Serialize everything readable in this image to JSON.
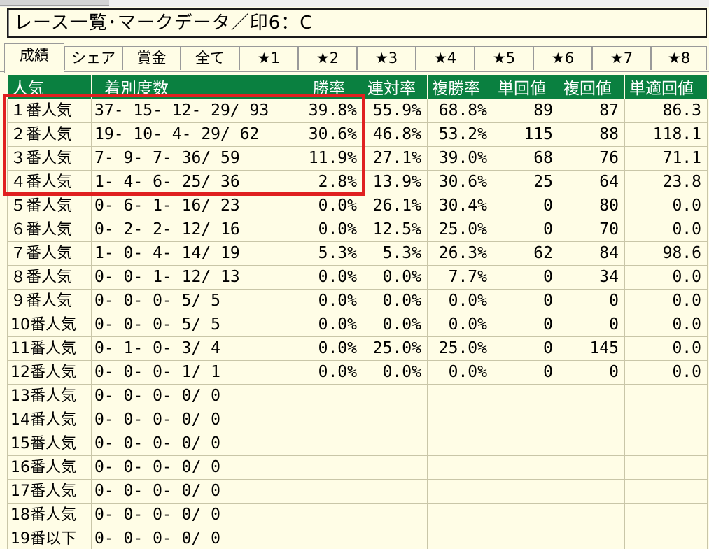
{
  "window": {
    "title": "レース一覧･マークデータ／印6：C"
  },
  "tabs": [
    {
      "label": "成績",
      "active": true
    },
    {
      "label": "シェア",
      "active": false
    },
    {
      "label": "賞金",
      "active": false
    },
    {
      "label": "全て",
      "active": false
    },
    {
      "label": "★1",
      "active": false
    },
    {
      "label": "★2",
      "active": false
    },
    {
      "label": "★3",
      "active": false
    },
    {
      "label": "★4",
      "active": false
    },
    {
      "label": "★5",
      "active": false
    },
    {
      "label": "★6",
      "active": false
    },
    {
      "label": "★7",
      "active": false
    },
    {
      "label": "★8",
      "active": false
    }
  ],
  "table": {
    "headers": {
      "popularity": "人気",
      "record": "着別度数",
      "win_rate": "勝率",
      "quinella_rate": "連対率",
      "place_rate": "複勝率",
      "win_return": "単回値",
      "place_return": "複回値",
      "adj_win_return": "単適回値"
    },
    "rows": [
      {
        "label": "１番人気",
        "record": "37- 15- 12- 29/ 93",
        "win_rate": "39.8%",
        "quinella_rate": "55.9%",
        "place_rate": "68.8%",
        "win_return": "89",
        "place_return": "87",
        "adj_win_return": "86.3"
      },
      {
        "label": "２番人気",
        "record": "19- 10-  4- 29/ 62",
        "win_rate": "30.6%",
        "quinella_rate": "46.8%",
        "place_rate": "53.2%",
        "win_return": "115",
        "place_return": "88",
        "adj_win_return": "118.1"
      },
      {
        "label": "３番人気",
        "record": " 7-  9-  7- 36/ 59",
        "win_rate": "11.9%",
        "quinella_rate": "27.1%",
        "place_rate": "39.0%",
        "win_return": "68",
        "place_return": "76",
        "adj_win_return": "71.1"
      },
      {
        "label": "４番人気",
        "record": " 1-  4-  6- 25/ 36",
        "win_rate": "2.8%",
        "quinella_rate": "13.9%",
        "place_rate": "30.6%",
        "win_return": "25",
        "place_return": "64",
        "adj_win_return": "23.8"
      },
      {
        "label": "５番人気",
        "record": " 0-  6-  1- 16/ 23",
        "win_rate": "0.0%",
        "quinella_rate": "26.1%",
        "place_rate": "30.4%",
        "win_return": "0",
        "place_return": "80",
        "adj_win_return": "0.0"
      },
      {
        "label": "６番人気",
        "record": " 0-  2-  2- 12/ 16",
        "win_rate": "0.0%",
        "quinella_rate": "12.5%",
        "place_rate": "25.0%",
        "win_return": "0",
        "place_return": "70",
        "adj_win_return": "0.0"
      },
      {
        "label": "７番人気",
        "record": " 1-  0-  4- 14/ 19",
        "win_rate": "5.3%",
        "quinella_rate": "5.3%",
        "place_rate": "26.3%",
        "win_return": "62",
        "place_return": "84",
        "adj_win_return": "98.6"
      },
      {
        "label": "８番人気",
        "record": " 0-  0-  1- 12/ 13",
        "win_rate": "0.0%",
        "quinella_rate": "0.0%",
        "place_rate": "7.7%",
        "win_return": "0",
        "place_return": "34",
        "adj_win_return": "0.0"
      },
      {
        "label": "９番人気",
        "record": " 0-  0-  0-  5/  5",
        "win_rate": "0.0%",
        "quinella_rate": "0.0%",
        "place_rate": "0.0%",
        "win_return": "0",
        "place_return": "0",
        "adj_win_return": "0.0"
      },
      {
        "label": "10番人気",
        "record": " 0-  0-  0-  5/  5",
        "win_rate": "0.0%",
        "quinella_rate": "0.0%",
        "place_rate": "0.0%",
        "win_return": "0",
        "place_return": "0",
        "adj_win_return": "0.0"
      },
      {
        "label": "11番人気",
        "record": " 0-  1-  0-  3/  4",
        "win_rate": "0.0%",
        "quinella_rate": "25.0%",
        "place_rate": "25.0%",
        "win_return": "0",
        "place_return": "145",
        "adj_win_return": "0.0"
      },
      {
        "label": "12番人気",
        "record": " 0-  0-  0-  1/  1",
        "win_rate": "0.0%",
        "quinella_rate": "0.0%",
        "place_rate": "0.0%",
        "win_return": "0",
        "place_return": "0",
        "adj_win_return": "0.0"
      },
      {
        "label": "13番人気",
        "record": " 0-  0-  0-  0/  0",
        "win_rate": "",
        "quinella_rate": "",
        "place_rate": "",
        "win_return": "",
        "place_return": "",
        "adj_win_return": ""
      },
      {
        "label": "14番人気",
        "record": " 0-  0-  0-  0/  0",
        "win_rate": "",
        "quinella_rate": "",
        "place_rate": "",
        "win_return": "",
        "place_return": "",
        "adj_win_return": ""
      },
      {
        "label": "15番人気",
        "record": " 0-  0-  0-  0/  0",
        "win_rate": "",
        "quinella_rate": "",
        "place_rate": "",
        "win_return": "",
        "place_return": "",
        "adj_win_return": ""
      },
      {
        "label": "16番人気",
        "record": " 0-  0-  0-  0/  0",
        "win_rate": "",
        "quinella_rate": "",
        "place_rate": "",
        "win_return": "",
        "place_return": "",
        "adj_win_return": ""
      },
      {
        "label": "17番人気",
        "record": " 0-  0-  0-  0/  0",
        "win_rate": "",
        "quinella_rate": "",
        "place_rate": "",
        "win_return": "",
        "place_return": "",
        "adj_win_return": ""
      },
      {
        "label": "18番人気",
        "record": " 0-  0-  0-  0/  0",
        "win_rate": "",
        "quinella_rate": "",
        "place_rate": "",
        "win_return": "",
        "place_return": "",
        "adj_win_return": ""
      },
      {
        "label": "19番以下",
        "record": " 0-  0-  0-  0/  0",
        "win_rate": "",
        "quinella_rate": "",
        "place_rate": "",
        "win_return": "",
        "place_return": "",
        "adj_win_return": ""
      }
    ]
  },
  "colors": {
    "header_bg": "#0a8040",
    "win_rate_text": "#8b0000",
    "quinella_rate_text": "#0000d0",
    "win_return_text": "#007000",
    "highlight_border": "#e02020",
    "background": "#fffde6"
  },
  "highlight": {
    "rows_from": 1,
    "rows_to": 4
  }
}
